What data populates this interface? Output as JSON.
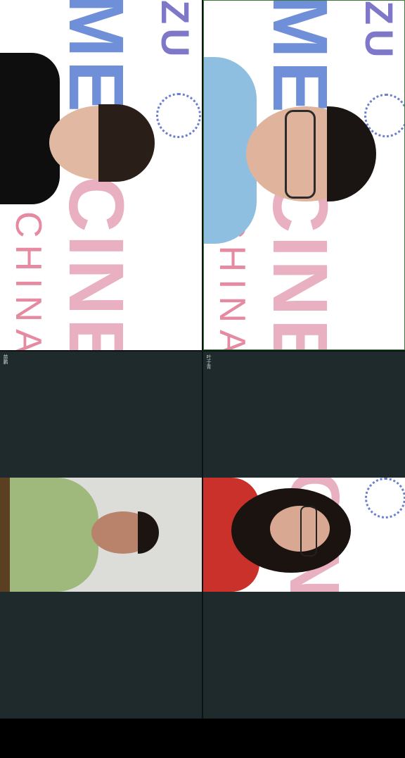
{
  "participants": [
    {
      "name": "",
      "position": "top-left"
    },
    {
      "name": "",
      "position": "top-right"
    },
    {
      "name_label": "苗鹏",
      "position": "bottom-left"
    },
    {
      "name_label": "叶于青",
      "position": "bottom-right"
    }
  ],
  "poster": {
    "line1": "ZU",
    "line2": "MED",
    "line3": "CINE",
    "line4": "CHINA"
  },
  "colors": {
    "tile_dark": "#1e2a2b",
    "active_speaker_border": "#3b7a3b",
    "poster_purple": "#7f78c8",
    "poster_blue": "#6f8fd8",
    "poster_pink": "#e58aa0"
  }
}
